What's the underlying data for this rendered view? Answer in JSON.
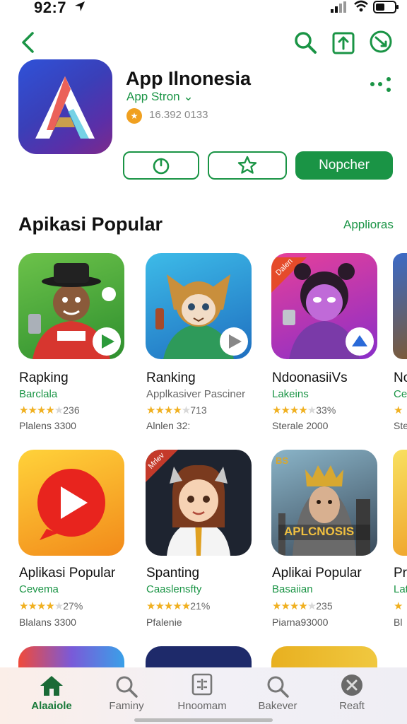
{
  "status_bar": {
    "time": "92:7"
  },
  "app": {
    "name": "App Ilnonesia",
    "store": "App Stron ⌄",
    "rating_text": "16.392 0133",
    "primary_button": "Nopcher"
  },
  "section": {
    "title": "Apikasi Popular",
    "link": "Applioras"
  },
  "row1": [
    {
      "title": "Rapking",
      "sub": "Barclala",
      "stars": 4,
      "rating": "236",
      "price": "Plalens 3300"
    },
    {
      "title": "Ranking",
      "sub": "Applkasiver Pasciner",
      "stars": 4,
      "rating": "713",
      "price": "Alnlen 32:"
    },
    {
      "title": "NdoonasiiVs",
      "sub": "Lakeins",
      "stars": 4,
      "rating": "33%",
      "price": "Sterale 2000"
    },
    {
      "title": "No",
      "sub": "Ce",
      "stars": 1,
      "rating": "",
      "price": "Ste"
    }
  ],
  "row2": [
    {
      "title": "Aplikasi Popular",
      "sub": "Cevema",
      "stars": 4,
      "rating": "27%",
      "price": "Blalans 3300"
    },
    {
      "title": "Spanting",
      "sub": "Caaslensfty",
      "stars": 5,
      "rating": "21%",
      "price": "Pfalenie"
    },
    {
      "title": "Aplikai Popular",
      "sub": "Basaiian",
      "stars": 4,
      "rating": "235",
      "price": "Piarna93000"
    },
    {
      "title": "Pr",
      "sub": "Lat",
      "stars": 1,
      "rating": "",
      "price": "Bl"
    }
  ],
  "badges": {
    "card3_row1": "Dalen",
    "card2_row2": "Mrlev",
    "card3_row2_banner": "APLCNOSIS",
    "card3_row2_corner": "BS"
  },
  "tabs": [
    {
      "label": "Alaaiole",
      "icon": "home-icon",
      "active": true
    },
    {
      "label": "Faminy",
      "icon": "search-icon",
      "active": false
    },
    {
      "label": "Hnoomam",
      "icon": "grid-icon",
      "active": false
    },
    {
      "label": "Bakever",
      "icon": "search-icon",
      "active": false
    },
    {
      "label": "Reaft",
      "icon": "clock-icon",
      "active": false
    }
  ],
  "colors": {
    "accent": "#1a9445",
    "star": "#f0b020"
  }
}
